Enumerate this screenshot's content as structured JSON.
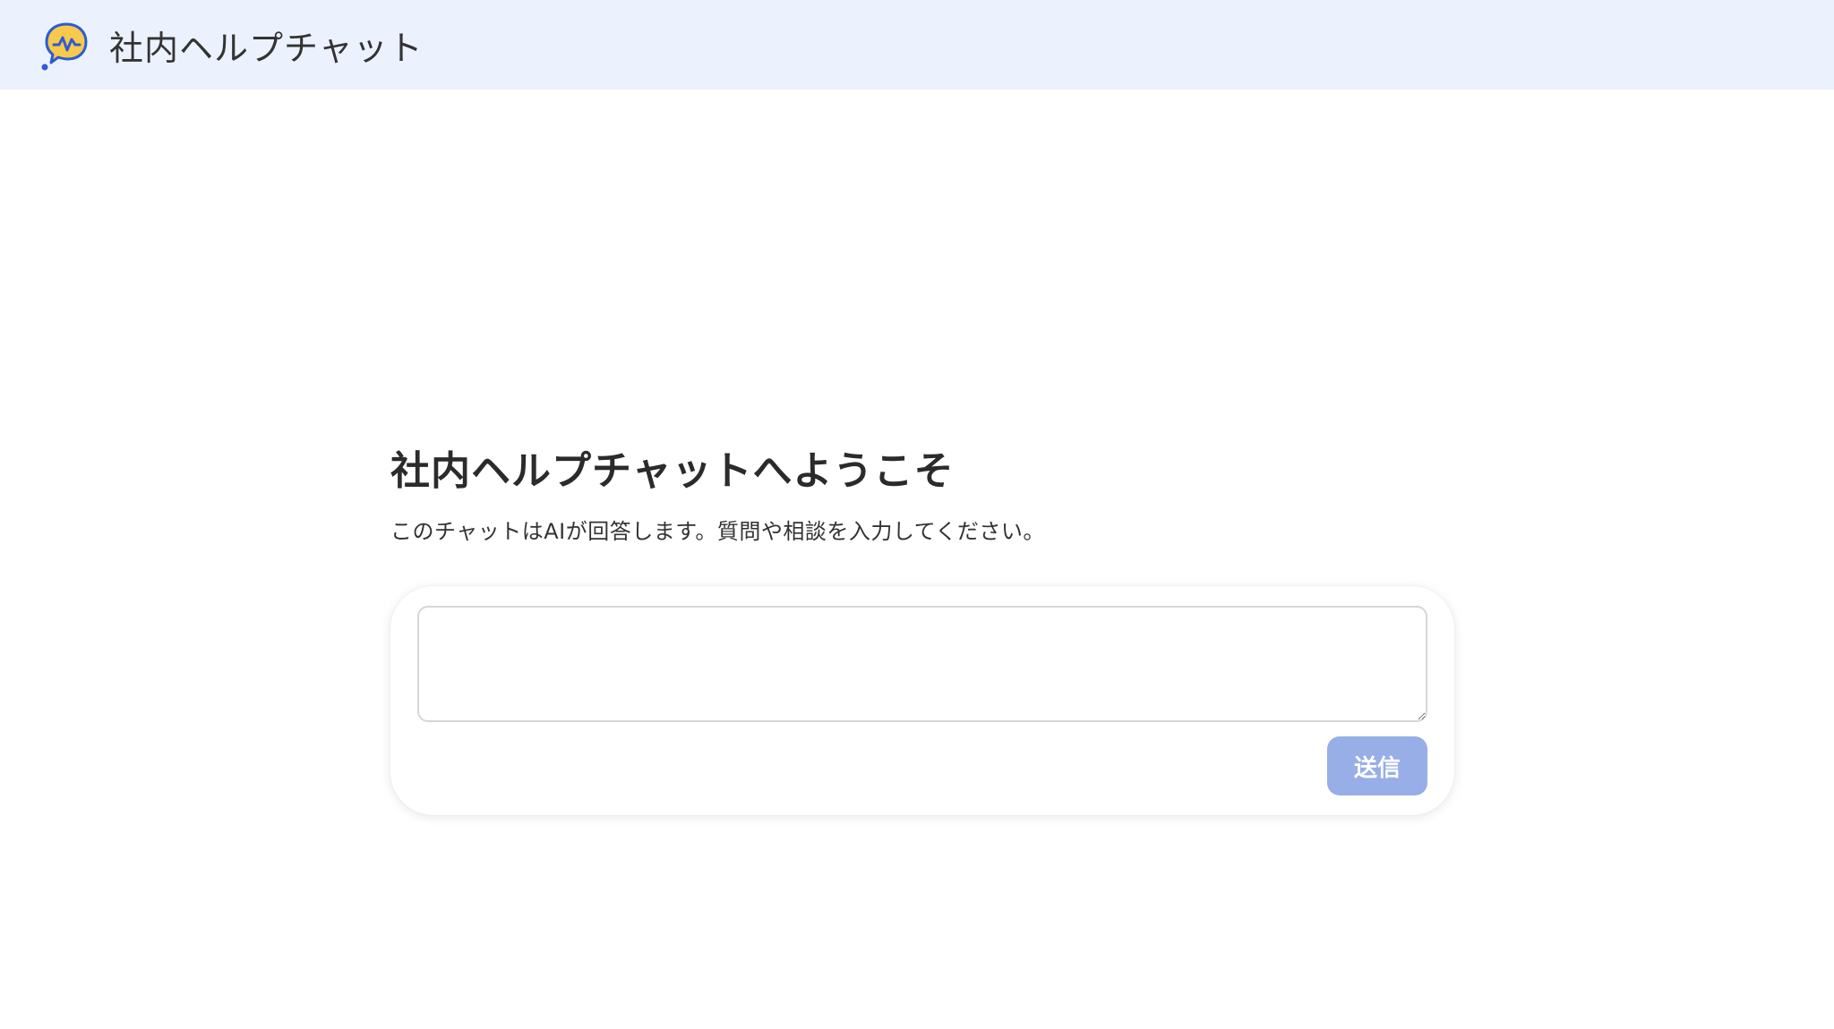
{
  "header": {
    "app_title": "社内ヘルプチャット",
    "logo_icon": "chat-bubble-pulse-icon"
  },
  "welcome": {
    "title": "社内ヘルプチャットへようこそ",
    "description": "このチャットはAIが回答します。質問や相談を入力してください。"
  },
  "chat": {
    "input_value": "",
    "input_placeholder": "",
    "send_label": "送信",
    "send_enabled": false
  },
  "colors": {
    "header_bg": "#ebf2fe",
    "logo_yellow": "#f8c94a",
    "logo_blue": "#2c5bd6",
    "send_button_disabled": "#97aee7"
  }
}
